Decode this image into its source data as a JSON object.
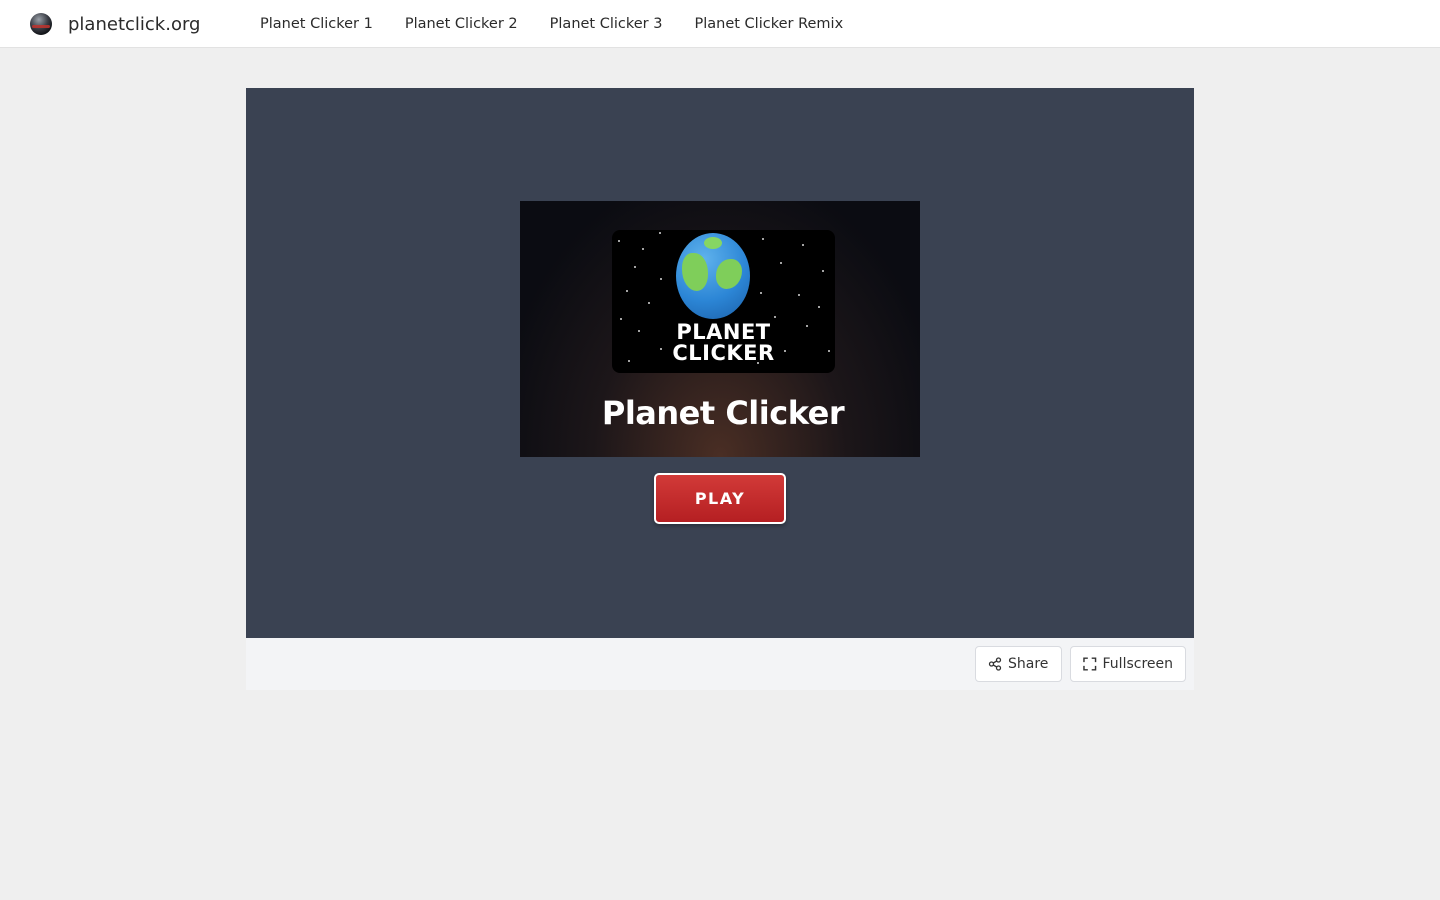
{
  "header": {
    "site_name": "planetclick.org",
    "logo_icon": "planet-logo-icon",
    "nav": [
      {
        "label": "Planet Clicker 1"
      },
      {
        "label": "Planet Clicker 2"
      },
      {
        "label": "Planet Clicker 3"
      },
      {
        "label": "Planet Clicker Remix"
      }
    ]
  },
  "game": {
    "cover_logo_text_line1": "PLANET",
    "cover_logo_text_line2": "CLICKER",
    "cover_title": "Planet Clicker",
    "play_label": "PLAY",
    "play_color": "#c62b2c",
    "panel_color": "#3a4252"
  },
  "toolbar": {
    "share_label": "Share",
    "share_icon": "share-icon",
    "fullscreen_label": "Fullscreen",
    "fullscreen_icon": "fullscreen-icon"
  }
}
